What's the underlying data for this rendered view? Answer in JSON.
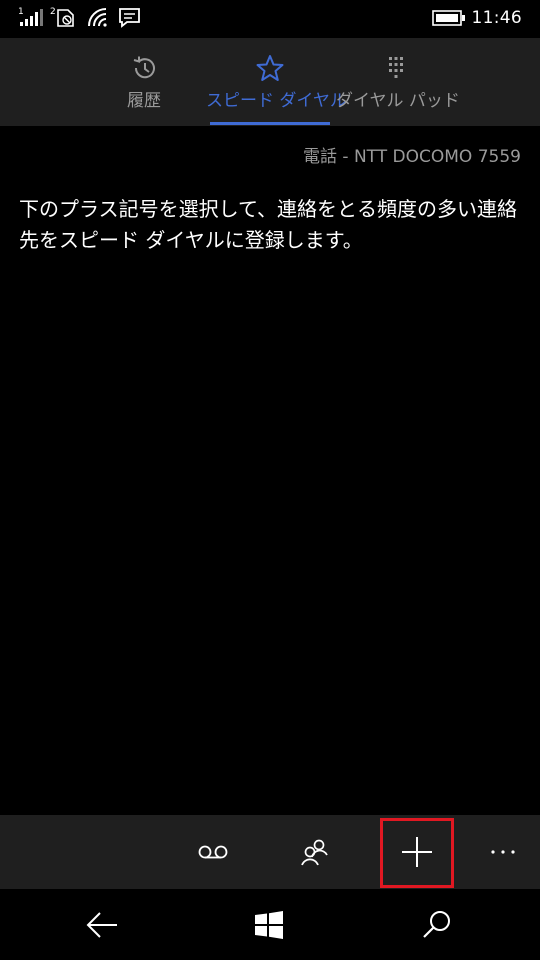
{
  "status_bar": {
    "sim1_index": "1",
    "sim2_index": "2",
    "time": "11:46",
    "icons": [
      "signal-icon",
      "sim-no-signal-icon",
      "wifi-icon",
      "message-icon",
      "battery-icon"
    ]
  },
  "tabs": [
    {
      "label": "履歴",
      "icon": "history-icon",
      "active": false
    },
    {
      "label": "スピード ダイヤル",
      "icon": "star-icon",
      "active": true
    },
    {
      "label": "ダイヤル パッド",
      "icon": "dialpad-icon",
      "active": false
    }
  ],
  "line_label": "電話 - NTT DOCOMO 7559",
  "instructions": "下のプラス記号を選択して、連絡をとる頻度の多い連絡先をスピード ダイヤルに登録します。",
  "app_bar": {
    "buttons": [
      "voicemail-icon",
      "contacts-icon",
      "add-icon",
      "more-icon"
    ],
    "more_glyph": "..."
  },
  "nav_bar": {
    "buttons": [
      "back-icon",
      "windows-start-icon",
      "search-icon"
    ]
  },
  "colors": {
    "accent": "#3f6bd4",
    "highlight": "#e01822",
    "header_bg": "#1f1f1f",
    "background": "#000000"
  }
}
